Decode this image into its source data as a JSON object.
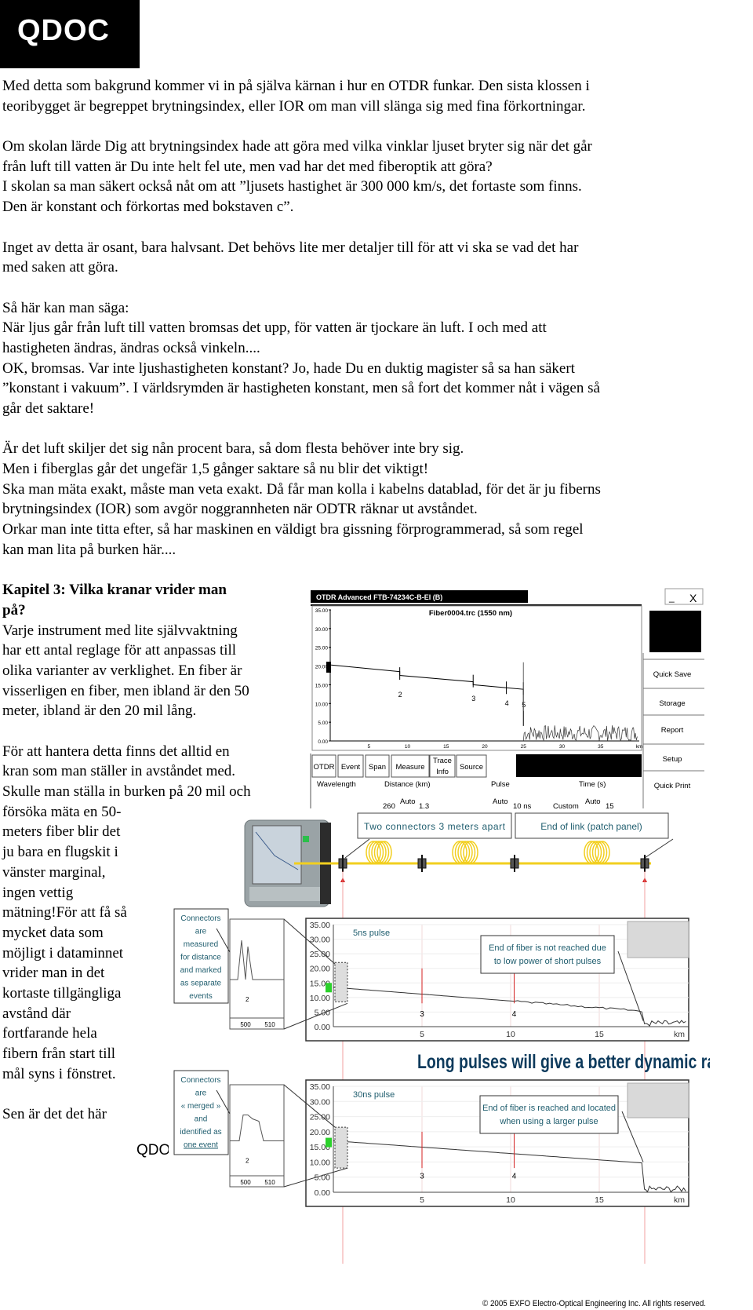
{
  "logo": {
    "text": "QDOC"
  },
  "body": {
    "lines": [
      {
        "t": "Med detta som bakgrund kommer vi in på själva kärnan i hur en OTDR funkar. Den sista klossen i"
      },
      {
        "t": "teoribygget är begreppet brytningsindex, eller IOR om man vill slänga sig med fina förkortningar."
      },
      {
        "t": ""
      },
      {
        "t": "Om skolan lärde Dig att brytningsindex hade att göra med vilka vinklar ljuset bryter sig när det går"
      },
      {
        "t": "från luft till vatten är Du inte helt fel ute, men vad har det med fiberoptik att göra?"
      },
      {
        "t": "I skolan sa man säkert också nåt om att ”ljusets hastighet är 300 000 km/s, det fortaste som finns."
      },
      {
        "t": "Den är konstant och förkortas med bokstaven c”."
      },
      {
        "t": ""
      },
      {
        "t": "Inget av detta är osant, bara halvsant. Det behövs lite mer detaljer till för att vi ska se vad det har"
      },
      {
        "t": "med saken att göra."
      },
      {
        "t": ""
      },
      {
        "t": "Så här kan man säga:"
      },
      {
        "t": "När ljus går från luft till vatten bromsas det upp, för vatten är tjockare än luft. I och med att"
      },
      {
        "t": "hastigheten ändras, ändras också vinkeln...."
      },
      {
        "t": "OK, bromsas. Var inte ljushastigheten konstant? Jo, hade Du en duktig magister så sa han säkert"
      },
      {
        "t": "”konstant i vakuum”. I världsrymden är hastigheten konstant, men så fort det kommer nåt i vägen så"
      },
      {
        "t": "går det saktare!"
      },
      {
        "t": ""
      },
      {
        "t": "Är det luft skiljer det sig nån procent bara, så dom flesta behöver inte bry sig."
      },
      {
        "t": "Men i fiberglas går det ungefär 1,5 gånger saktare så nu blir det viktigt!"
      },
      {
        "t": "Ska man mäta exakt, måste man veta exakt. Då får man kolla i kabelns datablad, för det är ju fiberns"
      },
      {
        "t": "brytningsindex (IOR) som avgör noggrannheten när ODTR räknar ut avståndet."
      },
      {
        "t": "Orkar man inte titta efter, så har maskinen en väldigt bra gissning förprogrammerad, så som regel"
      },
      {
        "t": "kan man lita på burken här...."
      },
      {
        "t": ""
      },
      {
        "t": "Kapitel 3: Vilka kranar vrider man",
        "h": true
      },
      {
        "t": "på?",
        "h": true
      },
      {
        "t": "Varje instrument med lite självvaktning"
      },
      {
        "t": "har ett antal reglage för att anpassas till"
      },
      {
        "t": "olika varianter av verklighet. En fiber är"
      },
      {
        "t": "visserligen en fiber, men ibland är den 50"
      },
      {
        "t": "meter, ibland är den 20 mil lång."
      },
      {
        "t": ""
      },
      {
        "t": "För att hantera detta finns det alltid en"
      },
      {
        "t": "kran som man ställer in avståndet med."
      },
      {
        "t": "Skulle man ställa in burken på 20 mil och"
      },
      {
        "t": "försöka mäta en 50-"
      },
      {
        "t": "meters fiber blir det"
      },
      {
        "t": "ju bara en flugskit i"
      },
      {
        "t": "vänster marginal,"
      },
      {
        "t": "ingen vettig"
      },
      {
        "t": "mätning!För att få så"
      },
      {
        "t": "mycket data som"
      },
      {
        "t": "möjligt i dataminnet"
      },
      {
        "t": "vrider man in det"
      },
      {
        "t": "kortaste tillgängliga"
      },
      {
        "t": "avstånd där"
      },
      {
        "t": "fortfarande hela"
      },
      {
        "t": "fibern från start till"
      },
      {
        "t": "mål syns i fönstret."
      },
      {
        "t": ""
      },
      {
        "t": "Sen är det det här"
      }
    ]
  },
  "footer": {
    "text": "QDO"
  },
  "otdr": {
    "title": "OTDR Advanced FTB-74234C-B-EI (B)",
    "trace_title": "Fiber0004.trc (1550 nm)",
    "y_ticks": [
      "35.00",
      "30.00",
      "25.00",
      "20.00",
      "15.00",
      "10.00",
      "5.00",
      "0.00"
    ],
    "x_ticks": [
      "5",
      "10",
      "15",
      "20",
      "25",
      "30",
      "35",
      "km"
    ],
    "events": [
      "2",
      "3",
      "4",
      "5"
    ],
    "side_buttons": [
      "Quick Save",
      "Storage",
      "Report",
      "Setup",
      "Quick Print"
    ],
    "tabs": [
      "OTDR",
      "Event",
      "Span",
      "Measure",
      "Trace Info",
      "Source"
    ],
    "fields": [
      "Wavelength",
      "Distance (km)",
      "Pulse",
      "Time (s)"
    ],
    "values": [
      "260",
      "Auto",
      "1.3",
      "Auto",
      "10 ns",
      "Custom",
      "Auto",
      "15"
    ],
    "window_controls": [
      "_",
      "X"
    ]
  },
  "diagram": {
    "callout_connectors": "Two connectors 3 meters apart",
    "callout_end": "End of link (patch panel)",
    "top_chart": {
      "pulse": "5ns pulse",
      "left_note": [
        "Connectors",
        "are",
        "measured",
        "for distance",
        "and marked",
        "as separate",
        "events"
      ],
      "note": [
        "End of fiber is not reached due",
        "to low power of short pulses"
      ],
      "inset_label": "2",
      "inset_ticks": [
        "500",
        "510"
      ],
      "events": [
        "3",
        "4"
      ]
    },
    "headline": "Long pulses will give a better dynamic range but less resolution:",
    "bottom_chart": {
      "pulse": "30ns pulse",
      "left_note": [
        "Connectors",
        "are",
        "« merged »",
        "and",
        "identified as",
        "one event"
      ],
      "note": [
        "End of fiber is reached and located",
        "when using a larger pulse"
      ],
      "inset_label": "2",
      "inset_ticks": [
        "500",
        "510"
      ],
      "events": [
        "3",
        "4"
      ]
    },
    "y_ticks": [
      "35.00",
      "30.00",
      "25.00",
      "20.00",
      "15.00",
      "10.00",
      "5.00",
      "0.00"
    ],
    "x_ticks": [
      "5",
      "10",
      "15",
      "km"
    ],
    "copyright": "© 2005 EXFO Electro-Optical Engineering Inc. All rights reserved.",
    "colors": {
      "fiber": "#f2cf1f",
      "headline": "#0d3a5c",
      "marker": "#d42020",
      "note_text": "#1f5d6e"
    }
  }
}
